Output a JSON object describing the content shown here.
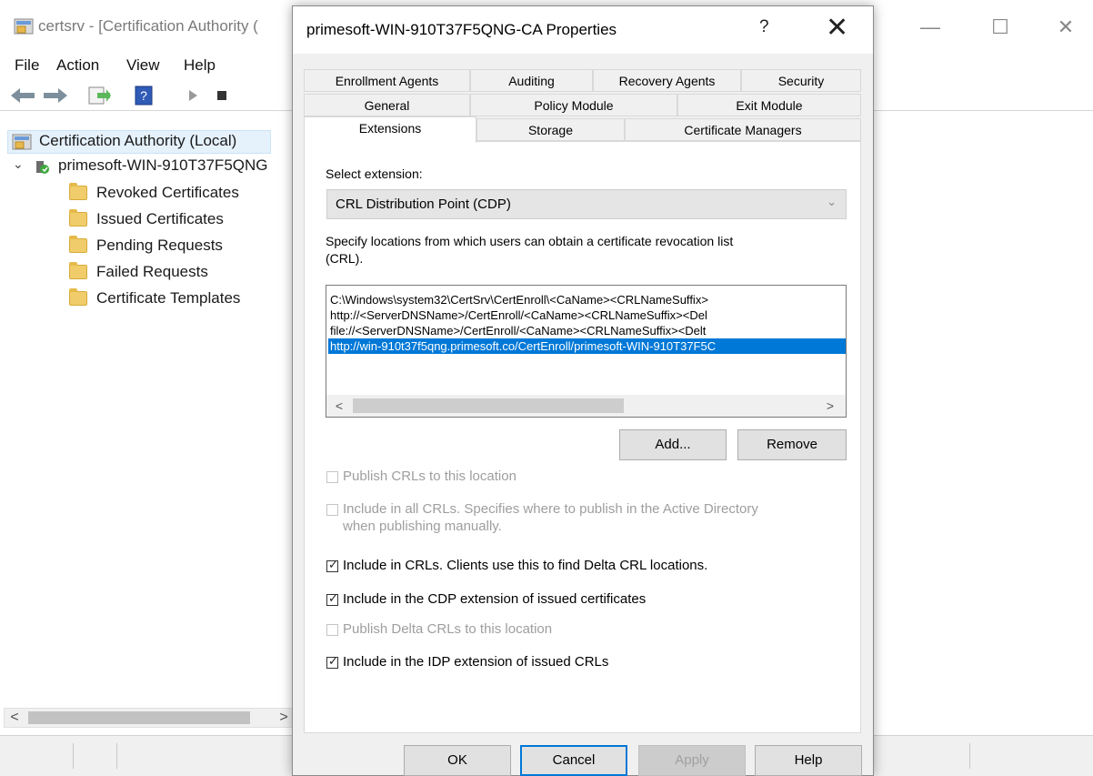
{
  "mmc": {
    "title": "certsrv - [Certification Authority (",
    "menu": [
      "File",
      "Action",
      "View",
      "Help"
    ],
    "tree": {
      "root": "Certification Authority (Local)",
      "ca": "primesoft-WIN-910T37F5QNG",
      "folders": [
        "Revoked Certificates",
        "Issued Certificates",
        "Pending Requests",
        "Failed Requests",
        "Certificate Templates"
      ]
    },
    "scroll_left": "<",
    "scroll_right": ">"
  },
  "dialog": {
    "title": "primesoft-WIN-910T37F5QNG-CA Properties",
    "help_glyph": "?",
    "close_glyph": "✕",
    "tabs_row1": [
      "Enrollment Agents",
      "Auditing",
      "Recovery Agents",
      "Security"
    ],
    "tabs_row2": [
      "General",
      "Policy Module",
      "Exit Module"
    ],
    "tabs_row3": [
      "Extensions",
      "Storage",
      "Certificate Managers"
    ],
    "select_extension_label": "Select extension:",
    "selected_extension": "CRL Distribution Point (CDP)",
    "description_line1": "Specify locations from which users can obtain a certificate revocation list",
    "description_line2": "(CRL).",
    "locations": [
      "C:\\Windows\\system32\\CertSrv\\CertEnroll\\<CaName><CRLNameSuffix>",
      "http://<ServerDNSName>/CertEnroll/<CaName><CRLNameSuffix><Del",
      "file://<ServerDNSName>/CertEnroll/<CaName><CRLNameSuffix><Delt",
      "http://win-910t37f5qng.primesoft.co/CertEnroll/primesoft-WIN-910T37F5C"
    ],
    "selected_location_index": 3,
    "list_left": "<",
    "list_right": ">",
    "add_button": "Add...",
    "remove_button": "Remove",
    "checkboxes": [
      {
        "line1": "Publish CRLs to this location",
        "line2": "",
        "checked": false,
        "enabled": false
      },
      {
        "line1": "Include in all CRLs. Specifies where to publish in the Active Directory",
        "line2": "when publishing manually.",
        "checked": false,
        "enabled": false
      },
      {
        "line1": "Include in CRLs. Clients use this to find Delta CRL locations.",
        "line2": "",
        "checked": true,
        "enabled": true
      },
      {
        "line1": "Include in the CDP extension of issued certificates",
        "line2": "",
        "checked": true,
        "enabled": true
      },
      {
        "line1": "Publish Delta CRLs to this location",
        "line2": "",
        "checked": false,
        "enabled": false
      },
      {
        "line1": "Include in the IDP extension of issued CRLs",
        "line2": "",
        "checked": true,
        "enabled": true
      }
    ],
    "footer_buttons": {
      "ok": "OK",
      "cancel": "Cancel",
      "apply": "Apply",
      "help": "Help"
    }
  },
  "colors": {
    "selection": "#0078d7",
    "dialog_bg": "#f0f0f0"
  }
}
